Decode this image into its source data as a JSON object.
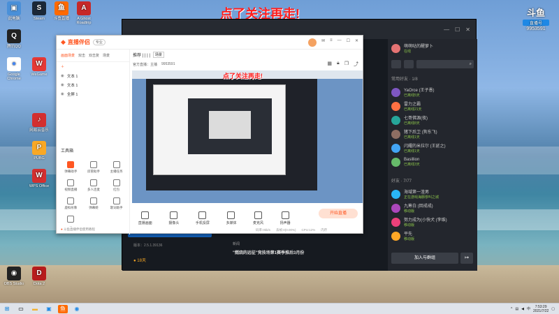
{
  "desktop": {
    "icons": [
      {
        "label": "此电脑",
        "color": "#4a90d9",
        "glyph": "▣"
      },
      {
        "label": "Steam",
        "color": "#1b2838",
        "glyph": "S"
      },
      {
        "label": "斗鱼直播",
        "color": "#ff6a00",
        "glyph": "鱼"
      },
      {
        "label": "A Ghost Roadtrip",
        "color": "#c62828",
        "glyph": "A"
      },
      {
        "label": "腾讯QQ",
        "color": "#222",
        "glyph": "Q"
      },
      {
        "label": "Google Chrome",
        "color": "#fff",
        "glyph": "●"
      },
      {
        "label": "WeGame",
        "color": "#e53935",
        "glyph": "W"
      },
      {
        "label": "网易云音乐",
        "color": "#d32f2f",
        "glyph": "♪"
      },
      {
        "label": "PUBG",
        "color": "#f9a825",
        "glyph": "P"
      },
      {
        "label": "WPS Office",
        "color": "#d32f2f",
        "glyph": "W"
      },
      {
        "label": "OBS Studio",
        "color": "#222",
        "glyph": "◉"
      },
      {
        "label": "Dota 2",
        "color": "#b71c1c",
        "glyph": "D"
      }
    ],
    "watermark_top": "点了关注再走!",
    "watermark_inner": "点了关注再走!"
  },
  "douyu": {
    "logo_text": "斗鱼",
    "logo_sub": "直播号",
    "room_id": "9953591",
    "user": {
      "name": "萌萌哒的醒萝卜",
      "status": "在线"
    },
    "friends_header": "常用好友 · 1/8",
    "friends": [
      {
        "name": "YaOrce (王子愚)",
        "sub": "已离线5天",
        "color": "#7e57c2"
      },
      {
        "name": "雷力之霸",
        "sub": "已离线21天",
        "color": "#ff7043"
      },
      {
        "name": "七哥佛源(夜)",
        "sub": "已离线8天",
        "color": "#26a69a"
      },
      {
        "name": "猪下后卫 (狗东飞)",
        "sub": "已离线1天",
        "color": "#8d6e63"
      },
      {
        "name": "闪耀的米拉尔 (王延之)",
        "sub": "已离线1天",
        "color": "#42a5f5"
      },
      {
        "name": "Basillion",
        "sub": "已离线3天",
        "color": "#66bb6a"
      }
    ],
    "all_friends_header": "好友 · 7/77",
    "online": [
      {
        "name": "海域第一渣男",
        "sub": "正在游戏海豚惨叫之城",
        "color": "#29b6f6"
      },
      {
        "name": "九筹白 (回戒戒)",
        "sub": "移动版",
        "color": "#ab47bc"
      },
      {
        "name": "努力成为(小快犬 (李维)",
        "sub": "移动版",
        "color": "#ec407a"
      },
      {
        "name": "平先",
        "sub": "移动版",
        "color": "#ffa726"
      }
    ],
    "join_button": "加入与群组",
    "bottom_title": "\"燃烧的远征\"竞技场第1赛季推后3月份",
    "bottom_tag": "新闻",
    "bottom_version": "版本：2.5.1.39136",
    "days": "18天"
  },
  "companion": {
    "app_name": "直播伴侣",
    "badge": "专业",
    "tabs": [
      "画面场景",
      "双击",
      "双击复",
      "场景"
    ],
    "scene_label": "推荐 | | | |",
    "scene_tab": "场景",
    "room_line": "官方直播：主播",
    "room_id": "9953591",
    "scenes": [
      "文本 1",
      "文本 1",
      "全屏 1"
    ],
    "tools_header": "工具箱",
    "tools": [
      "弹幕助手",
      "房管助手",
      "主播任务",
      "视频直播",
      "多人连麦",
      "红包",
      "虚拟形象",
      "弹幕姬",
      "歌词助手",
      "..."
    ],
    "hint": "斗鱼直播伴侣使用教程",
    "bottom": [
      "直播画面",
      "摄像头",
      "手机投屏",
      "多媒体",
      "麦克风",
      "扬声器"
    ],
    "start_button": "开始直播",
    "status": [
      "码率:0kb/s",
      "丢帧:0(0.00%)",
      "CPU:12%",
      "内存"
    ]
  },
  "taskbar": {
    "time": "7:53:29",
    "date": "2021/7/22",
    "lang": "中"
  },
  "colors": {
    "accent": "#ff5722",
    "watermark": "#ff1e1e",
    "douyu_bg": "#1f2229",
    "online_green": "#8bc34a"
  }
}
